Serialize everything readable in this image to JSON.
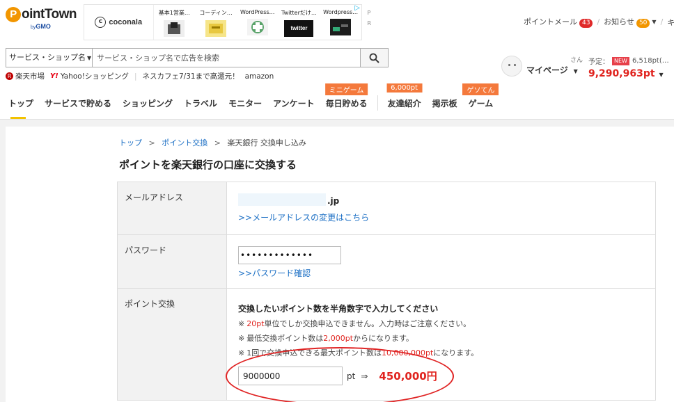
{
  "brand": {
    "logo_text": "ointTown",
    "logo_initial": "P",
    "gmo_prefix": "by",
    "gmo": "GMO"
  },
  "ads": {
    "coconala": "coconala",
    "items": [
      {
        "title": "基本1営業…"
      },
      {
        "title": "コーディン…"
      },
      {
        "title": "WordPress…"
      },
      {
        "title": "Twitterだけ…"
      },
      {
        "title": "Wordpress…"
      }
    ],
    "side_letters": [
      "P",
      "R"
    ],
    "twitter_text": "twitter"
  },
  "top_right": {
    "mail_label": "ポイントメール",
    "mail_count": "43",
    "notice_label": "お知らせ",
    "notice_count": "50",
    "more_label": "キャ"
  },
  "search": {
    "category": "サービス・ショップ名",
    "placeholder": "サービス・ショップ名で広告を検索"
  },
  "quick_links": {
    "rakuten": "楽天市場",
    "yahoo_icon": "Y!",
    "yahoo": "Yahoo!ショッピング",
    "promo": "ネスカフェ7/31まで高還元！",
    "amazon": "amazon"
  },
  "user": {
    "honorific": "さん",
    "mypage_label": "マイページ",
    "scheduled_label": "予定：",
    "new_badge": "NEW",
    "scheduled_points": "6,518pt(…",
    "total_points": "9,290,963pt"
  },
  "nav": {
    "items": [
      {
        "label": "トップ",
        "badge": ""
      },
      {
        "label": "サービスで貯める",
        "badge": ""
      },
      {
        "label": "ショッピング",
        "badge": ""
      },
      {
        "label": "トラベル",
        "badge": ""
      },
      {
        "label": "モニター",
        "badge": ""
      },
      {
        "label": "アンケート",
        "badge": ""
      },
      {
        "label": "毎日貯める",
        "badge": "ミニゲーム"
      },
      {
        "label": "友達紹介",
        "badge": "6,000pt"
      },
      {
        "label": "掲示板",
        "badge": ""
      },
      {
        "label": "ゲーム",
        "badge": "ゲソてん"
      }
    ]
  },
  "breadcrumb": {
    "top": "トップ",
    "exchange": "ポイント交換",
    "current": "楽天銀行 交換申し込み",
    "separator": ">"
  },
  "page_title": "ポイントを楽天銀行の口座に交換する",
  "form": {
    "email_label": "メールアドレス",
    "email_domain": ".jp",
    "email_change_link": ">>メールアドレスの変更はこちら",
    "password_label": "パスワード",
    "password_value": "•••••••••••••",
    "password_link": ">>パスワード確認",
    "point_label": "ポイント交換",
    "instruction": "交換したいポイント数を半角数字で入力してください",
    "note_mark": "※",
    "note1_red": "20pt",
    "note1_rest": "単位でしか交換申込できません。入力時はご注意ください。",
    "note2_pre": "最低交換ポイント数は",
    "note2_red": "2,000pt",
    "note2_rest": "からになります。",
    "note3_pre": "1回で交換申込できる最大ポイント数は",
    "note3_red": "10,000,000pt",
    "note3_rest": "になります。",
    "point_value": "9000000",
    "pt_unit": "pt",
    "arrow": "⇒",
    "yen_result": "450,000円"
  },
  "colors": {
    "accent_red": "#e0231e",
    "link_blue": "#1a6ec4",
    "nav_badge": "#f4793c",
    "annotation_circle": "#e02424"
  }
}
